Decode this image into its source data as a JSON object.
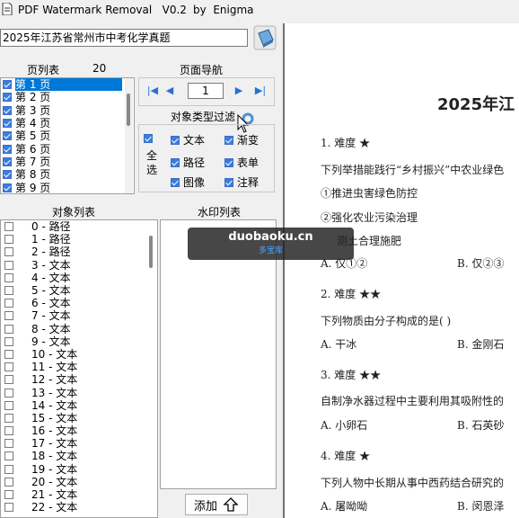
{
  "app": {
    "title": "PDF Watermark Removal   V0.2",
    "author": "by  Enigma"
  },
  "file": {
    "path": "2025年江苏省常州市中考化学真题"
  },
  "page_list": {
    "title": "页列表",
    "count": "20",
    "items": [
      {
        "label": "第 1 页",
        "selected": true
      },
      {
        "label": "第 2 页",
        "selected": false
      },
      {
        "label": "第 3 页",
        "selected": false
      },
      {
        "label": "第 4 页",
        "selected": false
      },
      {
        "label": "第 5 页",
        "selected": false
      },
      {
        "label": "第 6 页",
        "selected": false
      },
      {
        "label": "第 7 页",
        "selected": false
      },
      {
        "label": "第 8 页",
        "selected": false
      },
      {
        "label": "第 9 页",
        "selected": false
      }
    ]
  },
  "page_nav": {
    "title": "页面导航",
    "current": "1"
  },
  "filter": {
    "title": "对象类型过滤",
    "select_all": "全选",
    "items": [
      {
        "label": "文本",
        "checked": true
      },
      {
        "label": "渐变",
        "checked": true
      },
      {
        "label": "路径",
        "checked": true
      },
      {
        "label": "表单",
        "checked": true
      },
      {
        "label": "图像",
        "checked": true
      },
      {
        "label": "注释",
        "checked": true
      }
    ]
  },
  "object_list": {
    "title": "对象列表",
    "items": [
      "0 - 路径",
      "1 - 路径",
      "2 - 路径",
      "3 - 文本",
      "4 - 文本",
      "5 - 文本",
      "6 - 文本",
      "7 - 文本",
      "8 - 文本",
      "9 - 文本",
      "10 - 文本",
      "11 - 文本",
      "12 - 文本",
      "13 - 文本",
      "14 - 文本",
      "15 - 文本",
      "16 - 文本",
      "17 - 文本",
      "18 - 文本",
      "19 - 文本",
      "20 - 文本",
      "21 - 文本",
      "22 - 文本"
    ]
  },
  "watermark_list": {
    "title": "水印列表",
    "add_label": "添加"
  },
  "preview": {
    "doc_title": "2025年江",
    "q1_head": "1.  难度 ★",
    "q1_text": "下列举措能践行“乡村振兴”中农业绿色",
    "q1_opt1": "①推进虫害绿色防控",
    "q1_opt2": "②强化农业污染治理",
    "q1_opt3": "测土合理施肥",
    "q1_a": "A.  仅①②",
    "q1_b": "B.  仅②③",
    "q2_head": "2.  难度 ★★",
    "q2_text": "下列物质由分子构成的是(      )",
    "q2_a": "A.  干冰",
    "q2_b": "B.  金刚石",
    "q3_head": "3.  难度 ★★",
    "q3_text": "自制净水器过程中主要利用其吸附性的",
    "q3_a": "A.  小卵石",
    "q3_b": "B.  石英砂",
    "q4_head": "4.  难度 ★",
    "q4_text": "下列人物中长期从事中西药结合研究的",
    "q4_a": "A.  屠呦呦",
    "q4_b": "B.  闵恩泽"
  },
  "overlay": {
    "main": "duobaoku.cn",
    "sub": "多宝库"
  },
  "colors": {
    "selection": "#0078d7",
    "check": "#3a7de0",
    "nav_arrow": "#2a6fd6"
  }
}
